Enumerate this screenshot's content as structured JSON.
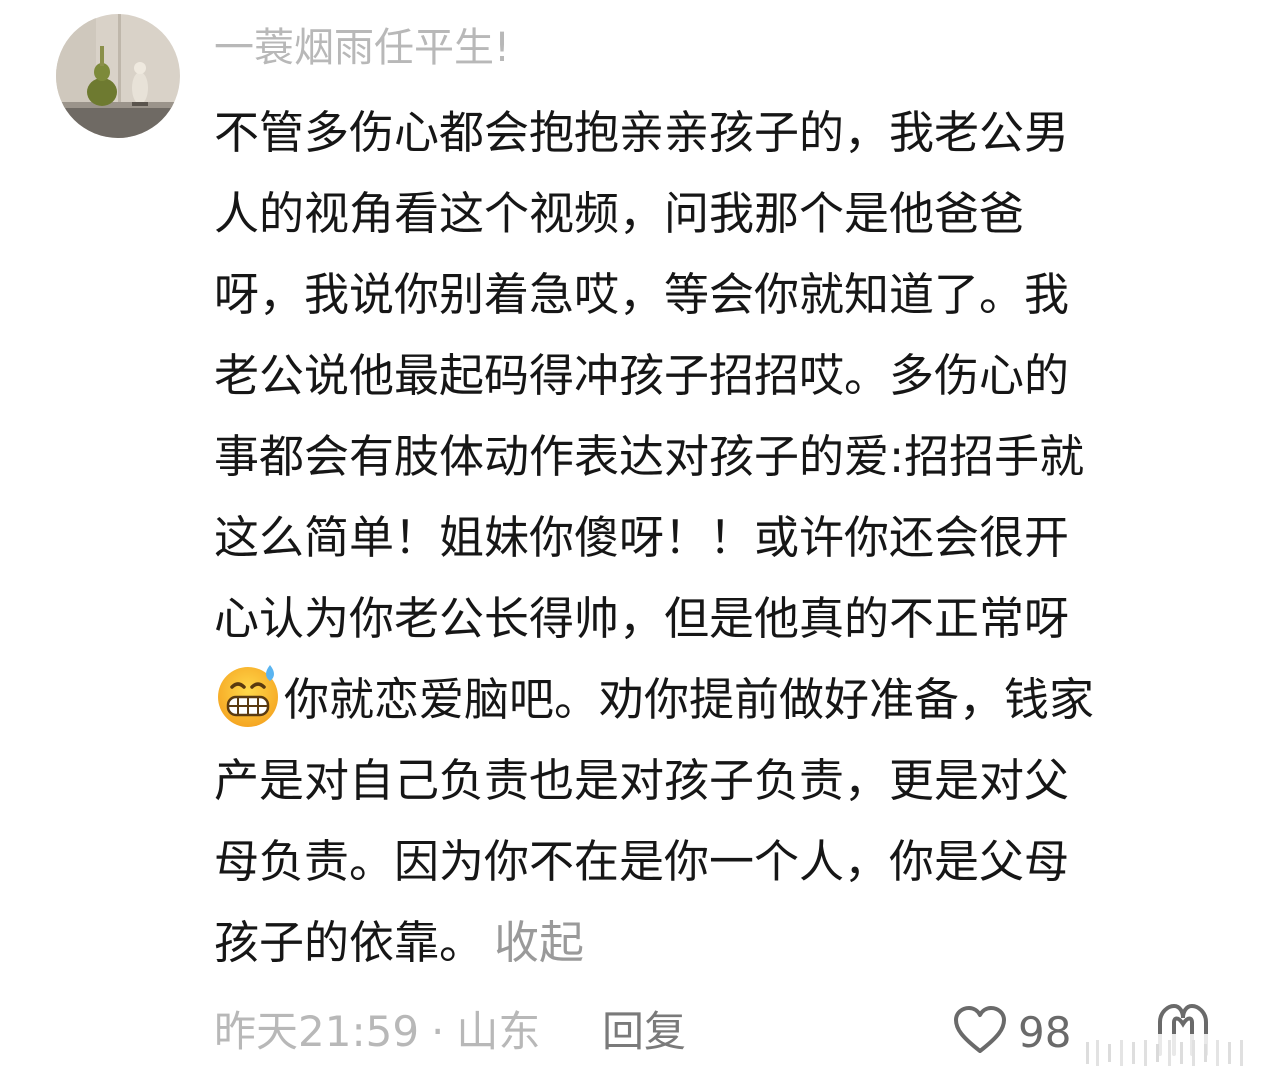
{
  "comment": {
    "username": "一蓑烟雨任平生!",
    "lines": [
      "不管多伤心都会抱抱亲亲孩子的，我老公男",
      "人的视角看这个视频，问我那个是他爸爸",
      "呀，我说你别着急哎，等会你就知道了。我",
      "老公说他最起码得冲孩子招招哎。多伤心的",
      "事都会有肢体动作表达对孩子的爱:招招手就",
      "这么简单！姐妹你傻呀！！或许你还会很开",
      "心认为你老公长得帅，但是他真的不正常呀",
      "你就恋爱脑吧。劝你提前做好准备，钱家",
      "产是对自己负责也是对孩子负责，更是对父",
      "母负责。因为你不在是你一个人，你是父母",
      "孩子的依靠。"
    ],
    "collapse_label": "收起",
    "emoji": "grimacing-sweat-emoji",
    "time": "昨天21:59",
    "separator": "·",
    "location": "山东",
    "reply_label": "回复",
    "like_count": "98"
  },
  "colors": {
    "text": "#161616",
    "muted": "#b8b8b8",
    "collapse": "#9a9a9a",
    "icon": "#6a6a6a",
    "background": "#ffffff"
  }
}
